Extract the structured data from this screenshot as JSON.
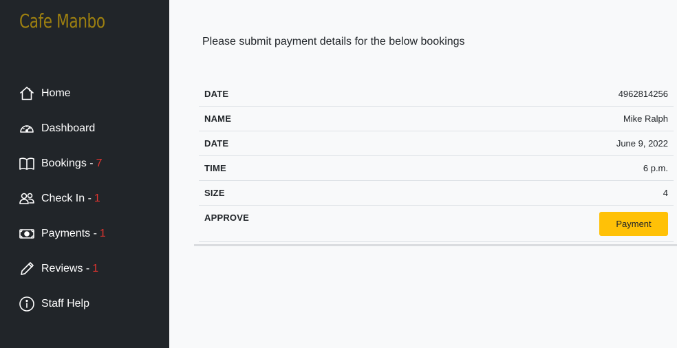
{
  "app": {
    "brand": "Cafe Manbo"
  },
  "sidebar": {
    "items": [
      {
        "label": "Home",
        "icon": "home-icon",
        "count": ""
      },
      {
        "label": "Dashboard",
        "icon": "speedometer-icon",
        "count": ""
      },
      {
        "label": "Bookings - ",
        "icon": "book-icon",
        "count": "7"
      },
      {
        "label": "Check In - ",
        "icon": "people-icon",
        "count": "1"
      },
      {
        "label": "Payments - ",
        "icon": "cash-icon",
        "count": "1"
      },
      {
        "label": "Reviews - ",
        "icon": "pencil-icon",
        "count": "1"
      },
      {
        "label": "Staff Help",
        "icon": "info-icon",
        "count": ""
      }
    ]
  },
  "main": {
    "intro": "Please submit payment details for the below bookings",
    "rows": [
      {
        "label": "DATE",
        "value": "4962814256"
      },
      {
        "label": "NAME",
        "value": "Mike Ralph"
      },
      {
        "label": "DATE",
        "value": "June 9, 2022"
      },
      {
        "label": "TIME",
        "value": "6 p.m."
      },
      {
        "label": "SIZE",
        "value": "4"
      },
      {
        "label": "APPROVE",
        "button": "Payment"
      }
    ]
  },
  "colors": {
    "sidebar_bg": "#212529",
    "brand": "#9c7f10",
    "count": "#e1342f",
    "button": "#ffc107",
    "page_bg": "#f8f9fa"
  }
}
